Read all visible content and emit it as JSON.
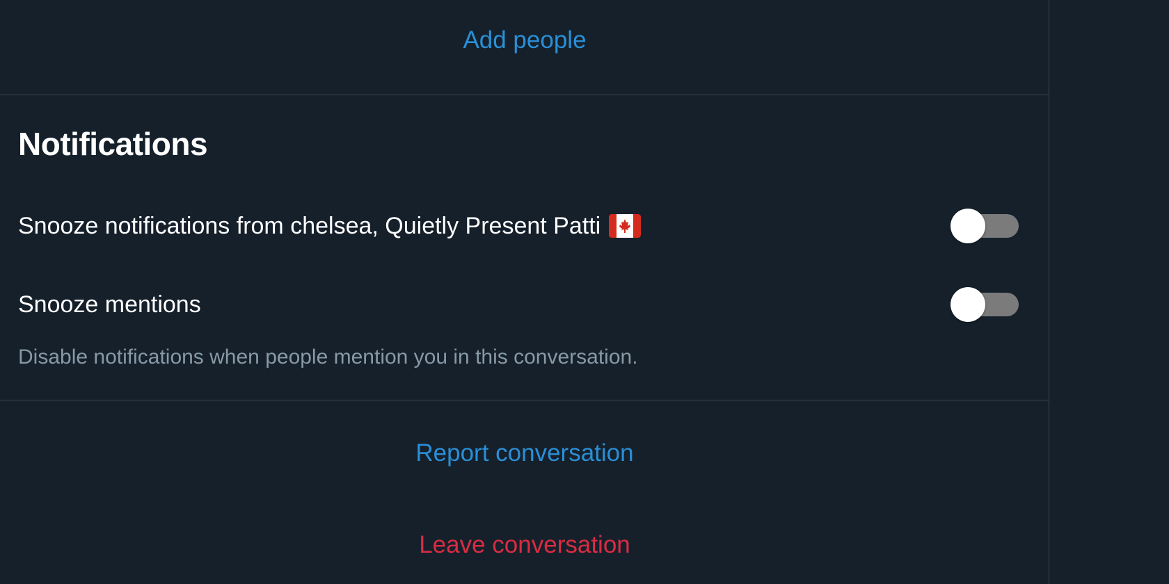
{
  "conversation_info": {
    "add_people_label": "Add people",
    "notifications": {
      "title": "Notifications",
      "snooze_notifications": {
        "label": "Snooze notifications from chelsea, Quietly Present Patti",
        "flag_icon": "canada-flag-icon",
        "enabled": false
      },
      "snooze_mentions": {
        "label": "Snooze mentions",
        "enabled": false,
        "description": "Disable notifications when people mention you in this conversation."
      }
    },
    "report_label": "Report conversation",
    "leave_label": "Leave conversation"
  },
  "colors": {
    "background": "#15202b",
    "link_blue": "#2a8fd6",
    "danger_red": "#d92c43",
    "divider": "#38444d",
    "secondary_text": "#8899a6",
    "toggle_track_off": "#7b7b7b"
  }
}
